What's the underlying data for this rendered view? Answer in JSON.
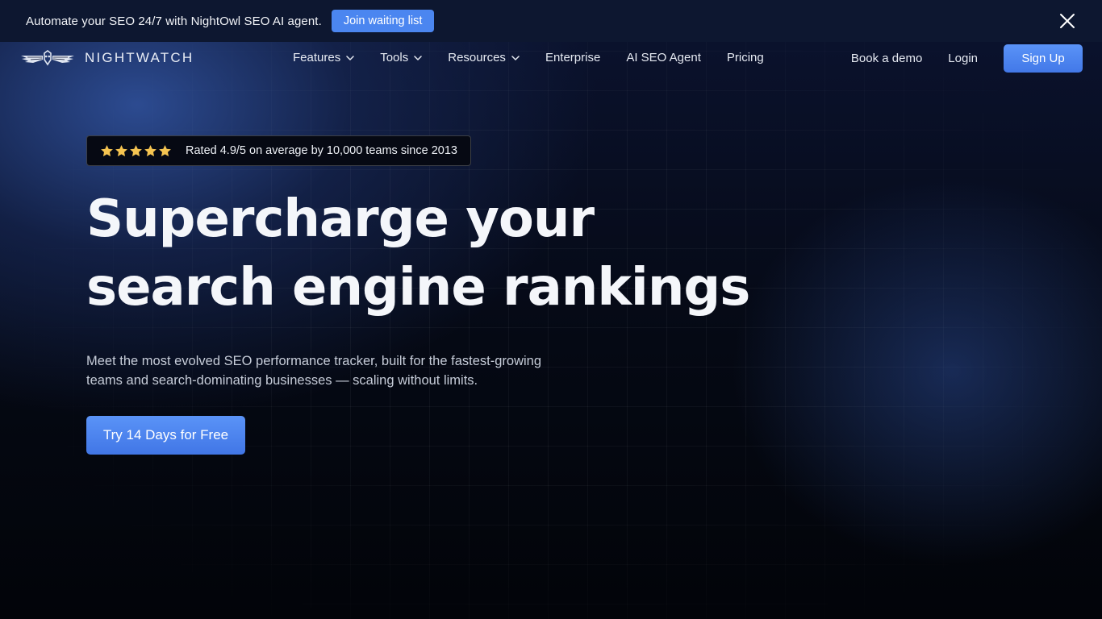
{
  "banner": {
    "text": "Automate your SEO 24/7 with NightOwl SEO AI agent.",
    "button_label": "Join waiting list",
    "close_icon": "close-icon"
  },
  "nav": {
    "logo_text": "NIGHTWATCH",
    "logo_icon": "owl-wings-logo-icon",
    "items": [
      {
        "label": "Features",
        "dropdown": true
      },
      {
        "label": "Tools",
        "dropdown": true
      },
      {
        "label": "Resources",
        "dropdown": true
      },
      {
        "label": "Enterprise",
        "dropdown": false
      },
      {
        "label": "AI SEO Agent",
        "dropdown": false
      },
      {
        "label": "Pricing",
        "dropdown": false
      }
    ],
    "book_demo": "Book a demo",
    "login": "Login",
    "signup": "Sign Up"
  },
  "hero": {
    "rating_stars": 5,
    "rating_text": "Rated 4.9/5 on average by 10,000 teams since 2013",
    "headline": "Supercharge your search engine rankings",
    "subtext": "Meet the most evolved SEO performance tracker, built for the fastest-growing teams and search-dominating businesses — scaling without limits.",
    "cta_label": "Try 14 Days for Free"
  },
  "colors": {
    "accent": "#4b86f0",
    "banner_bg": "#0d1730",
    "star": "#f5c451",
    "text": "#f4f6fa"
  }
}
